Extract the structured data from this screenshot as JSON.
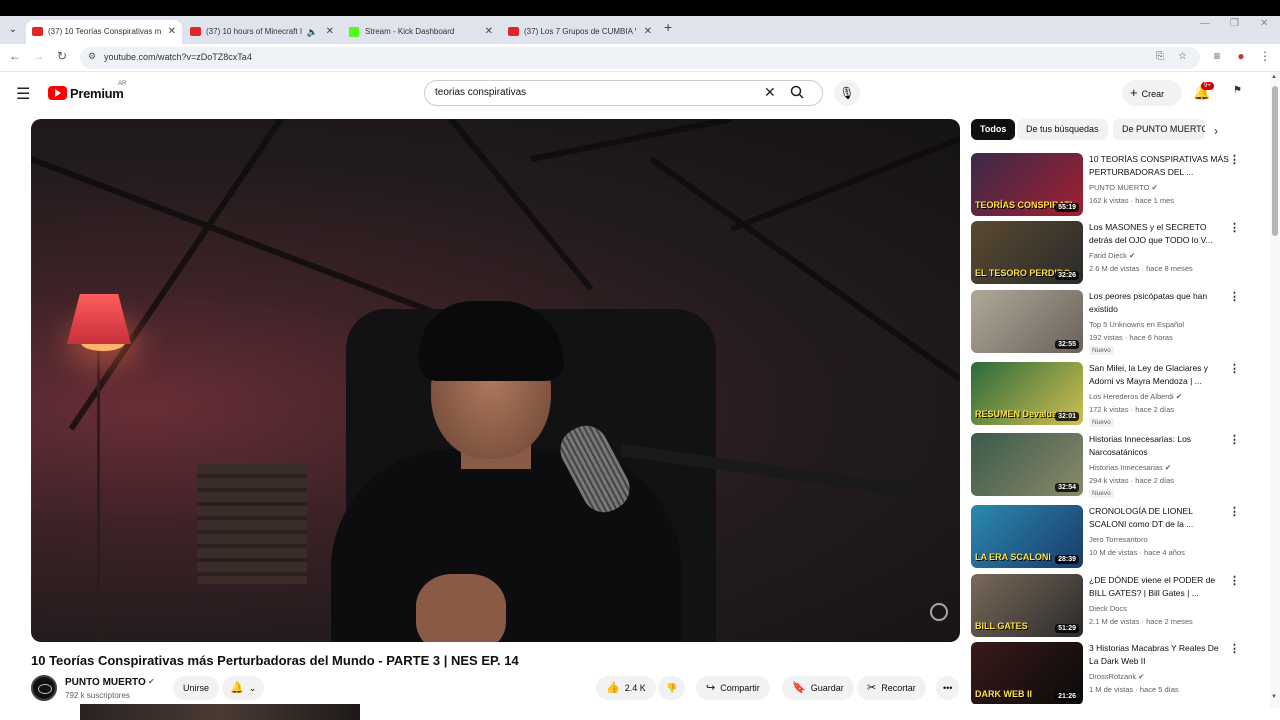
{
  "browser": {
    "tabs": [
      {
        "title": "(37) 10 Teorías Conspirativas m",
        "favicon": "youtube-icon",
        "active": true
      },
      {
        "title": "(37) 10 hours of Minecraft I",
        "favicon": "youtube-icon",
        "active": false,
        "audio": true
      },
      {
        "title": "Stream - Kick Dashboard",
        "favicon": "kick-icon",
        "active": false
      },
      {
        "title": "(37) Los 7 Grupos de CUMBIA V",
        "favicon": "youtube-icon",
        "active": false
      }
    ],
    "url": "youtube.com/watch?v=zDoTZ8cxTa4"
  },
  "header": {
    "logo_text": "Premium",
    "country": "AR",
    "search_value": "teorias conspirativas",
    "create_label": "Crear",
    "notifications_badge": "9+"
  },
  "video": {
    "title": "10 Teorías Conspirativas más Perturbadoras del Mundo - PARTE 3 | NES EP. 14",
    "channel": "PUNTO MUERTO",
    "subscribers": "792 k suscriptores",
    "join_label": "Unirse",
    "likes": "2.4 K",
    "share_label": "Compartir",
    "save_label": "Guardar",
    "clip_label": "Recortar"
  },
  "chips": [
    "Todos",
    "De tus búsquedas",
    "De PUNTO MUERTO"
  ],
  "recommendations": [
    {
      "title": "10 TEORÍAS CONSPIRATIVAS MÁS PERTURBADORAS DEL ...",
      "channel": "PUNTO MUERTO",
      "verified": true,
      "meta": "162 k vistas · hace 1 mes",
      "duration": "55:19",
      "thumb_text": "TEORÍAS CONSPIRATI",
      "badge": "",
      "colors": [
        "#3a2a4a",
        "#a02030"
      ]
    },
    {
      "title": "Los MASONES y el SECRETO detrás del OJO que TODO lo V...",
      "channel": "Farid Dieck",
      "verified": true,
      "meta": "2.6 M de vistas · hace 8 meses",
      "duration": "32:26",
      "thumb_text": "EL TESORO PERDIDO",
      "badge": "",
      "colors": [
        "#5a4a30",
        "#2a2a2a"
      ]
    },
    {
      "title": "Los peores psicópatas que han existido",
      "channel": "Top 5 Unknowns en Español",
      "verified": false,
      "meta": "192 vistas · hace 6 horas",
      "duration": "32:55",
      "thumb_text": "",
      "badge": "Nuevo",
      "colors": [
        "#b0a898",
        "#6a625a"
      ]
    },
    {
      "title": "San Milei, la Ley de Glaciares y Adorni vs Mayra Mendoza | ...",
      "channel": "Los Herederos de Alberdi",
      "verified": true,
      "meta": "172 k vistas · hace 2 días",
      "duration": "32:01",
      "thumb_text": "RESUMEN Devaluado",
      "badge": "Nuevo",
      "colors": [
        "#2a6a3a",
        "#d0c050"
      ]
    },
    {
      "title": "Historias Innecesarias: Los Narcosatánicos",
      "channel": "Historias Innecesarias",
      "verified": true,
      "meta": "294 k vistas · hace 2 días",
      "duration": "32:54",
      "thumb_text": "",
      "badge": "Nuevo",
      "colors": [
        "#3a5a4a",
        "#8a8a6a"
      ]
    },
    {
      "title": "CRONOLOGÍA DE LIONEL SCALONI como DT de la ...",
      "channel": "Jero Torresantoro",
      "verified": false,
      "meta": "10 M de vistas · hace 4 años",
      "duration": "28:39",
      "thumb_text": "LA ERA SCALONI",
      "badge": "",
      "colors": [
        "#2a8ab0",
        "#1a3a6a"
      ]
    },
    {
      "title": "¿DE DÓNDE viene el PODER de BILL GATES? | Bill Gates | ...",
      "channel": "Dieck Docs",
      "verified": false,
      "meta": "2.1 M de vistas · hace 2 meses",
      "duration": "51:29",
      "thumb_text": "BILL GATES",
      "badge": "",
      "colors": [
        "#7a6a5a",
        "#2a2a2a"
      ]
    },
    {
      "title": "3 Historias Macabras Y Reales De La Dark Web II",
      "channel": "DrossRotzank",
      "verified": true,
      "meta": "1 M de vistas · hace 5 días",
      "duration": "21:26",
      "thumb_text": "DARK WEB II",
      "badge": "",
      "colors": [
        "#3a1a1a",
        "#0a0a0a"
      ]
    }
  ]
}
